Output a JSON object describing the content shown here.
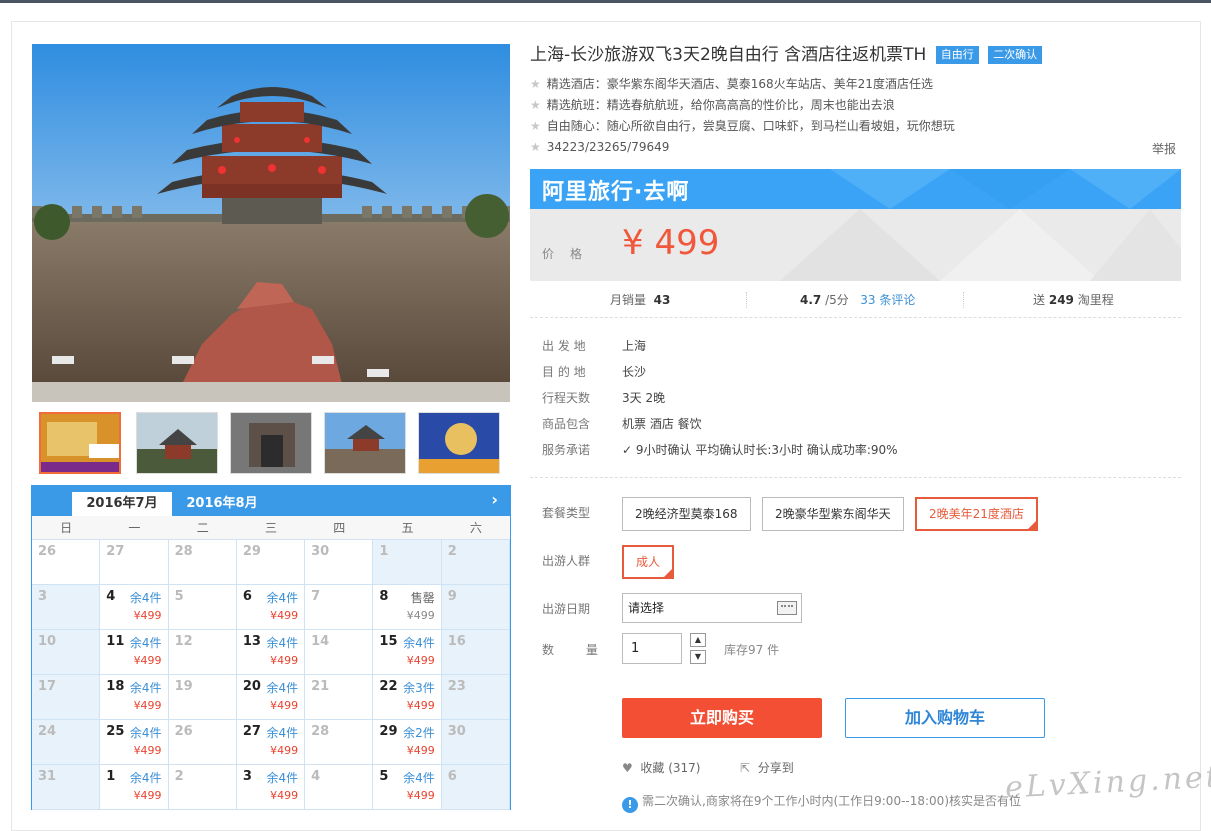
{
  "title": "上海-长沙旅游双飞3天2晚自由行 含酒店往返机票TH",
  "tags": [
    "自由行",
    "二次确认"
  ],
  "features": [
    "精选酒店：豪华紫东阁华天酒店、莫泰168火车站店、美年21度酒店任选",
    "精选航班：精选春航航班，给你高高高的性价比，周末也能出去浪",
    "自由随心：随心所欲自由行，尝臭豆腐、口味虾，到马栏山看坡姐，玩你想玩",
    "34223/23265/79649"
  ],
  "report": "举报",
  "banner": {
    "brand": "阿里旅行·去啊"
  },
  "price": {
    "label": "价格",
    "value": "¥ 499"
  },
  "stats": {
    "monthly_label": "月销量",
    "monthly_value": "43",
    "rating": "4.7",
    "rating_suffix": "/5分",
    "reviews": "33 条评论",
    "points_prefix": "送",
    "points_value": "249",
    "points_suffix": "淘里程"
  },
  "info": [
    {
      "k": "出 发 地",
      "v": "上海"
    },
    {
      "k": "目 的 地",
      "v": "长沙"
    },
    {
      "k": "行程天数",
      "v": "3天 2晚"
    },
    {
      "k": "商品包含",
      "v": "机票   酒店   餐饮"
    },
    {
      "k": "服务承诺",
      "v": "9小时确认    平均确认时长:3小时    确认成功率:90%"
    }
  ],
  "package": {
    "label": "套餐类型",
    "options": [
      "2晚经济型莫泰168",
      "2晚豪华型紫东阁华天",
      "2晚美年21度酒店"
    ],
    "selected": 2
  },
  "group": {
    "label": "出游人群",
    "options": [
      "成人"
    ]
  },
  "date": {
    "label": "出游日期",
    "placeholder": "请选择"
  },
  "quantity": {
    "label": "数 量",
    "value": "1",
    "stock": "库存97 件"
  },
  "buttons": {
    "buy": "立即购买",
    "cart": "加入购物车"
  },
  "social": {
    "fav": "收藏 (317)",
    "share": "分享到"
  },
  "notice": "需二次确认,商家将在9个工作小时内(工作日9:00--18:00)核实是否有位",
  "watermark": "eLvXing.net",
  "calendar": {
    "tabs": [
      "2016年7月",
      "2016年8月"
    ],
    "weekdays": [
      "日",
      "一",
      "二",
      "三",
      "四",
      "五",
      "六"
    ],
    "cells": [
      {
        "d": "26"
      },
      {
        "d": "27"
      },
      {
        "d": "28"
      },
      {
        "d": "29"
      },
      {
        "d": "30"
      },
      {
        "d": "1"
      },
      {
        "d": "2"
      },
      {
        "d": "3"
      },
      {
        "d": "4",
        "stock": "余4件",
        "price": "¥499"
      },
      {
        "d": "5"
      },
      {
        "d": "6",
        "stock": "余4件",
        "price": "¥499"
      },
      {
        "d": "7"
      },
      {
        "d": "8",
        "stock": "售罄",
        "price": "¥499",
        "sold": true
      },
      {
        "d": "9"
      },
      {
        "d": "10"
      },
      {
        "d": "11",
        "stock": "余4件",
        "price": "¥499"
      },
      {
        "d": "12"
      },
      {
        "d": "13",
        "stock": "余4件",
        "price": "¥499"
      },
      {
        "d": "14"
      },
      {
        "d": "15",
        "stock": "余4件",
        "price": "¥499"
      },
      {
        "d": "16"
      },
      {
        "d": "17"
      },
      {
        "d": "18",
        "stock": "余4件",
        "price": "¥499"
      },
      {
        "d": "19"
      },
      {
        "d": "20",
        "stock": "余4件",
        "price": "¥499"
      },
      {
        "d": "21"
      },
      {
        "d": "22",
        "stock": "余3件",
        "price": "¥499"
      },
      {
        "d": "23"
      },
      {
        "d": "24"
      },
      {
        "d": "25",
        "stock": "余4件",
        "price": "¥499"
      },
      {
        "d": "26"
      },
      {
        "d": "27",
        "stock": "余4件",
        "price": "¥499"
      },
      {
        "d": "28"
      },
      {
        "d": "29",
        "stock": "余2件",
        "price": "¥499"
      },
      {
        "d": "30"
      },
      {
        "d": "31"
      },
      {
        "d": "1",
        "stock": "余4件",
        "price": "¥499"
      },
      {
        "d": "2"
      },
      {
        "d": "3",
        "stock": "余4件",
        "price": "¥499"
      },
      {
        "d": "4"
      },
      {
        "d": "5",
        "stock": "余4件",
        "price": "¥499"
      },
      {
        "d": "6"
      }
    ]
  },
  "colors": {
    "accent": "#3b9ae8",
    "price": "#f0573b",
    "buy": "#f24f35"
  }
}
